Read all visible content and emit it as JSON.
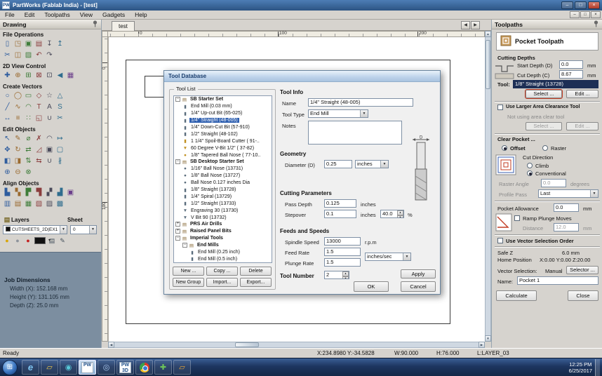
{
  "window": {
    "title": "PartWorks (Fablab India) - [test]",
    "app_badge": "PW"
  },
  "menu": {
    "items": [
      "File",
      "Edit",
      "Toolpaths",
      "View",
      "Gadgets",
      "Help"
    ]
  },
  "left_panel": {
    "title": "Drawing",
    "sections": [
      {
        "name": "File Operations",
        "rows": [
          [
            {
              "n": "new-file-icon",
              "g": "▯"
            },
            {
              "n": "open-file-icon",
              "g": "◳"
            },
            {
              "n": "save-icon",
              "g": "▣"
            },
            {
              "n": "print-icon",
              "g": "▤"
            },
            {
              "n": "import-vectors-icon",
              "g": "↧"
            },
            {
              "n": "export-vectors-icon",
              "g": "↥"
            }
          ],
          [
            {
              "n": "cut-icon",
              "g": "✂"
            },
            {
              "n": "copy-icon",
              "g": "◫"
            },
            {
              "n": "paste-icon",
              "g": "▨"
            },
            {
              "n": "undo-icon",
              "g": "↶"
            },
            {
              "n": "redo-icon",
              "g": "↷"
            }
          ]
        ]
      },
      {
        "name": "2D View Control",
        "rows": [
          [
            {
              "n": "pan-icon",
              "g": "✚"
            },
            {
              "n": "zoom-in-icon",
              "g": "⊕"
            },
            {
              "n": "zoom-box-icon",
              "g": "⊞"
            },
            {
              "n": "zoom-extents-icon",
              "g": "⊠"
            },
            {
              "n": "zoom-selected-icon",
              "g": "⊡"
            },
            {
              "n": "previous-view-icon",
              "g": "◀"
            },
            {
              "n": "toggle-grid-icon",
              "g": "▦"
            }
          ]
        ]
      },
      {
        "name": "Create Vectors",
        "rows": [
          [
            {
              "n": "circle-icon",
              "g": "○"
            },
            {
              "n": "ellipse-icon",
              "g": "◯"
            },
            {
              "n": "rectangle-icon",
              "g": "▭"
            },
            {
              "n": "polygon-icon",
              "g": "◇"
            },
            {
              "n": "star-icon",
              "g": "☆"
            },
            {
              "n": "triangle-icon",
              "g": "△"
            }
          ],
          [
            {
              "n": "polyline-icon",
              "g": "╱"
            },
            {
              "n": "curve-icon",
              "g": "∿"
            },
            {
              "n": "arc-icon",
              "g": "◠"
            },
            {
              "n": "text-icon",
              "g": "T"
            },
            {
              "n": "text-block-icon",
              "g": "A"
            },
            {
              "n": "text-on-curve-icon",
              "g": "S"
            }
          ],
          [
            {
              "n": "dimension-icon",
              "g": "↔"
            },
            {
              "n": "offset-vectors-icon",
              "g": "≡"
            },
            {
              "n": "array-copy-icon",
              "g": "∷"
            },
            {
              "n": "nest-vectors-icon",
              "g": "◱"
            },
            {
              "n": "weld-icon",
              "g": "∪"
            },
            {
              "n": "trim-icon",
              "g": "✂"
            }
          ]
        ]
      },
      {
        "name": "Edit Objects",
        "rows": [
          [
            {
              "n": "select-icon",
              "g": "↖"
            },
            {
              "n": "node-edit-icon",
              "g": "✎"
            },
            {
              "n": "measure-icon",
              "g": "⌀"
            },
            {
              "n": "delete-icon",
              "g": "✗"
            },
            {
              "n": "fillet-icon",
              "g": "◠"
            },
            {
              "n": "extend-icon",
              "g": "↦"
            }
          ],
          [
            {
              "n": "move-icon",
              "g": "✥"
            },
            {
              "n": "rotate-icon",
              "g": "↻"
            },
            {
              "n": "mirror-icon",
              "g": "⇄"
            },
            {
              "n": "scale-icon",
              "g": "◿"
            },
            {
              "n": "group-icon",
              "g": "▣"
            },
            {
              "n": "ungroup-icon",
              "g": "▢"
            }
          ],
          [
            {
              "n": "align-left-edge-icon",
              "g": "◧"
            },
            {
              "n": "align-right-edge-icon",
              "g": "◨"
            },
            {
              "n": "flip-vertical-icon",
              "g": "⇅"
            },
            {
              "n": "flip-horizontal-icon",
              "g": "⇆"
            },
            {
              "n": "join-vectors-icon",
              "g": "∪"
            },
            {
              "n": "break-vectors-icon",
              "g": "∦"
            }
          ],
          [
            {
              "n": "weld-boolean-icon",
              "g": "⊕"
            },
            {
              "n": "subtract-boolean-icon",
              "g": "⊖"
            },
            {
              "n": "intersect-boolean-icon",
              "g": "⊗"
            }
          ]
        ]
      },
      {
        "name": "Align Objects",
        "rows": [
          [
            {
              "n": "align-left-icon",
              "g": "▙"
            },
            {
              "n": "align-center-icon",
              "g": "▚"
            },
            {
              "n": "align-right-icon",
              "g": "▛"
            },
            {
              "n": "align-top-icon",
              "g": "▜"
            },
            {
              "n": "align-middle-icon",
              "g": "▞"
            },
            {
              "n": "align-bottom-icon",
              "g": "▟"
            },
            {
              "n": "center-in-material-icon",
              "g": "▣"
            }
          ],
          [
            {
              "n": "space-horizontal-icon",
              "g": "▥"
            },
            {
              "n": "space-vertical-icon",
              "g": "▤"
            },
            {
              "n": "mirror-array-icon",
              "g": "▦"
            },
            {
              "n": "distribute-icon",
              "g": "▧"
            },
            {
              "n": "align-to-selection-icon",
              "g": "▨"
            },
            {
              "n": "align-to-sheet-icon",
              "g": "▩"
            }
          ]
        ]
      }
    ],
    "layers": {
      "title": "Layers",
      "sheet_title": "Sheet",
      "layer_value": "CUTSHEETS_2D|EX1",
      "sheet_value": "0",
      "icons": [
        {
          "n": "show-all-layers-icon",
          "g": "●",
          "c": "#d9a60a"
        },
        {
          "n": "toggle-visibility-icon",
          "g": "●",
          "c": "#8d939b"
        },
        {
          "n": "active-layer-color-icon",
          "g": "●",
          "c": "#c32222"
        },
        {
          "n": "layer-color-swatch",
          "swatch": true
        },
        {
          "n": "new-layer-icon",
          "g": "▤",
          "c": "#44505c"
        },
        {
          "n": "edit-layers-icon",
          "g": "✎",
          "c": "#44505c"
        }
      ]
    },
    "job_dimensions": {
      "title": "Job Dimensions",
      "width": "Width (X): 152.168 mm",
      "height": "Height (Y): 131.105 mm",
      "depth": "Depth (Z): 25.0 mm"
    }
  },
  "canvas": {
    "tab": "test",
    "ruler_top": [
      "0",
      "100",
      "200"
    ],
    "ruler_left": [
      "0",
      "100"
    ]
  },
  "tool_database": {
    "title": "Tool Database",
    "tool_list_label": "Tool List",
    "tree": [
      {
        "label": "SB Starter Set",
        "level": 0,
        "group": true
      },
      {
        "label": "End Mill (0.03 mm)",
        "level": 1,
        "g": "▮",
        "c": "#5a6c7c"
      },
      {
        "label": "1/4\" Up-cut Bit (65-025)",
        "level": 1,
        "g": "▮",
        "c": "#5a6c7c"
      },
      {
        "label": "1/4\" Straight  (48-005)",
        "level": 1,
        "g": "▮",
        "c": "#5a6c7c",
        "selected": true
      },
      {
        "label": "1/4\" Down-Cut Bit (57-910)",
        "level": 1,
        "g": "▮",
        "c": "#5a6c7c"
      },
      {
        "label": "1/2\" Straight  (48-102)",
        "level": 1,
        "g": "▮",
        "c": "#5a6c7c"
      },
      {
        "label": "1 1/4\" Spoil-Board Cutter ( 91-..",
        "level": 1,
        "g": "▮",
        "c": "#c09020"
      },
      {
        "label": "60 Degree V-Bit 1/2\"  ( 37-82)",
        "level": 1,
        "g": "▼",
        "c": "#c09020"
      },
      {
        "label": "1/8\" Tapered Ball Nose ( 77-10..",
        "level": 1,
        "g": "●",
        "c": "#c09020"
      },
      {
        "label": "SB Desktop Starter Set",
        "level": 0,
        "group": true
      },
      {
        "label": "1/16\" Ball Nose (13731)",
        "level": 1,
        "g": "●",
        "c": "#5a6c7c"
      },
      {
        "label": "1/8\" Ball Nose (13727)",
        "level": 1,
        "g": "●",
        "c": "#5a6c7c"
      },
      {
        "label": "Ball Nose 0.127 inches Dia",
        "level": 1,
        "g": "●",
        "c": "#5a6c7c"
      },
      {
        "label": "1/8\" Straight (13728)",
        "level": 1,
        "g": "▮",
        "c": "#5a6c7c"
      },
      {
        "label": "1/4\" Spiral (13729)",
        "level": 1,
        "g": "▮",
        "c": "#5a6c7c"
      },
      {
        "label": "1/2\" Straight (13733)",
        "level": 1,
        "g": "▮",
        "c": "#5a6c7c"
      },
      {
        "label": "Engraving 30 (13730)",
        "level": 1,
        "g": "▼",
        "c": "#5a6c7c"
      },
      {
        "label": "V Bit 90 (13732)",
        "level": 1,
        "g": "▼",
        "c": "#5a6c7c"
      },
      {
        "label": "PRS Air Drills",
        "level": 0,
        "group": true,
        "collapsed": true
      },
      {
        "label": "Raised Panel Bits",
        "level": 0,
        "group": true,
        "collapsed": true
      },
      {
        "label": "Imperial Tools",
        "level": 0,
        "group": true
      },
      {
        "label": "End Mills",
        "level": 1,
        "group": true
      },
      {
        "label": "End Mill (0.25 inch)",
        "level": 2,
        "g": "▮",
        "c": "#5a6c7c"
      },
      {
        "label": "End Mill (0.5 inch)",
        "level": 2,
        "g": "▮",
        "c": "#5a6c7c"
      }
    ],
    "list_buttons_row1": [
      "New ...",
      "Copy ...",
      "Delete"
    ],
    "list_buttons_row2": [
      "New Group",
      "Import...",
      "Export..."
    ],
    "tool_info": {
      "heading": "Tool Info",
      "name_label": "Name",
      "name_value": "1/4\" Straight  (48-005)",
      "tool_type_label": "Tool Type",
      "tool_type_value": "End Mill",
      "notes_label": "Notes",
      "notes_value": ""
    },
    "geometry": {
      "heading": "Geometry",
      "diameter_label": "Diameter (D)",
      "diameter_value": "0.25",
      "diameter_units": "inches"
    },
    "cutting_parameters": {
      "heading": "Cutting Parameters",
      "pass_depth_label": "Pass Depth",
      "pass_depth_value": "0.125",
      "pass_depth_units": "inches",
      "stepover_label": "Stepover",
      "stepover_value": "0.1",
      "stepover_units": "inches",
      "stepover_percent": "40.0",
      "percent_sign": "%"
    },
    "feeds_speeds": {
      "heading": "Feeds and Speeds",
      "spindle_label": "Spindle Speed",
      "spindle_value": "13000",
      "spindle_units": "r.p.m",
      "feed_label": "Feed Rate",
      "feed_value": "1.5",
      "plunge_label": "Plunge Rate",
      "plunge_value": "1.5",
      "rate_units": "inches/sec"
    },
    "tool_number_label": "Tool Number",
    "tool_number_value": "2",
    "apply_label": "Apply",
    "ok_label": "OK",
    "cancel_label": "Cancel"
  },
  "toolpaths_panel": {
    "title": "Toolpaths",
    "header": "Pocket Toolpath",
    "cutting_depths": {
      "heading": "Cutting Depths",
      "start_depth_label": "Start Depth (D)",
      "start_depth_value": "0.0",
      "cut_depth_label": "Cut Depth (C)",
      "cut_depth_value": "8.67",
      "units": "mm"
    },
    "tool": {
      "label": "Tool:",
      "name": "1/8\" Straight (13728)",
      "select_label": "Select ...",
      "edit_label": "Edit ..."
    },
    "clearance": {
      "checkbox_label": "Use Larger Area Clearance Tool",
      "status": "Not using area clear tool",
      "select_label": "Select ...",
      "edit_label": "Edit ..."
    },
    "clear_pocket": {
      "heading": "Clear Pocket ...",
      "offset_label": "Offset",
      "raster_label": "Raster",
      "cut_direction_label": "Cut Direction",
      "climb_label": "Climb",
      "conventional_label": "Conventional",
      "raster_angle_label": "Raster Angle",
      "raster_angle_value": "0.0",
      "raster_angle_units": "degrees",
      "profile_pass_label": "Profile Pass",
      "profile_pass_value": "Last"
    },
    "pocket_allowance": {
      "label": "Pocket Allowance",
      "value": "0.0",
      "units": "mm"
    },
    "ramp": {
      "checkbox_label": "Ramp Plunge Moves",
      "distance_label": "Distance",
      "distance_value": "12.0",
      "units": "mm"
    },
    "vector_order": {
      "checkbox_label": "Use Vector Selection Order"
    },
    "safe_z": {
      "label": "Safe Z",
      "value": "6.0 mm"
    },
    "home": {
      "label": "Home Position",
      "value": "X:0.00 Y:0.00 Z:20.00"
    },
    "vector_selection": {
      "label": "Vector Selection:",
      "value": "Manual",
      "button_label": "Selector ..."
    },
    "name_field": {
      "label": "Name:",
      "value": "Pocket 1"
    },
    "calculate_label": "Calculate",
    "close_label": "Close"
  },
  "status_bar": {
    "ready": "Ready",
    "coords": "X:234.8980  Y:-34.5828",
    "w": "W:90.000",
    "h": "H:76.000",
    "layer": "L:LAYER_03"
  },
  "taskbar": {
    "clock_time": "12:25 PM",
    "clock_date": "6/25/2017",
    "icons": [
      {
        "n": "ie-taskbar-icon",
        "g": "e",
        "color": "#7ec4f2",
        "italic": true
      },
      {
        "n": "explorer-taskbar-icon",
        "g": "▱",
        "color": "#ecc84f"
      },
      {
        "n": "media-player-taskbar-icon",
        "g": "◉",
        "color": "#58c8d8"
      },
      {
        "n": "partworks-taskbar-icon",
        "tile": "PW",
        "active": true
      },
      {
        "n": "disc-burner-taskbar-icon",
        "g": "◎",
        "color": "#a8c8f0"
      },
      {
        "n": "partworks-3d-taskbar-icon",
        "tile": "PW",
        "tile2": "3D"
      },
      {
        "n": "chrome-taskbar-icon",
        "chrome": true
      },
      {
        "n": "green-app-taskbar-icon",
        "g": "✚",
        "color": "#6cc45a"
      },
      {
        "n": "documents-folder-taskbar-icon",
        "g": "▱",
        "color": "#e8a83a"
      }
    ]
  }
}
